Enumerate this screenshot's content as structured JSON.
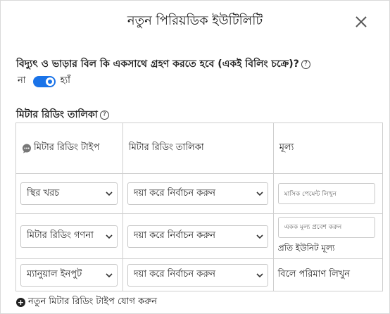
{
  "dialog": {
    "title": "নতুন পিরিয়ডিক ইউটিলিটি",
    "close_icon": "close-icon"
  },
  "billing": {
    "question": "বিদ্যুৎ ও ভাড়ার বিল কি একসাথে গ্রহণ করতে হবে (একই বিলিং চক্রে)?",
    "help_glyph": "?",
    "toggle_off_label": "না",
    "toggle_on_label": "হ্যাঁ",
    "toggle_state": "on",
    "accent_color": "#1a73e8"
  },
  "meter_table": {
    "section_title": "মিটার রিডিং তালিকা",
    "help_glyph": "?",
    "headers": [
      "মিটার রিডিং টাইপ",
      "মিটার রিডিং তালিকা",
      "মূল্য"
    ],
    "rows": [
      {
        "type": "স্থির খরচ",
        "list": "দয়া করে নির্বাচন করুন",
        "value_placeholder": "মাসিক পেমেন্ট লিখুন",
        "value_note": ""
      },
      {
        "type": "মিটার রিডিং গণনা",
        "list": "দয়া করে নির্বাচন করুন",
        "value_placeholder": "একক মূল্য প্রবেশ করুন",
        "value_note": "প্রতি ইউনিট মূল্য"
      },
      {
        "type": "ম্যানুয়াল ইনপুট",
        "list": "দয়া করে নির্বাচন করুন",
        "value_placeholder": "",
        "value_note": "বিলে পরিমাণ লিখুন"
      }
    ]
  },
  "add_button": {
    "glyph": "+",
    "label": "নতুন মিটার রিডিং টাইপ যোগ করুন"
  }
}
